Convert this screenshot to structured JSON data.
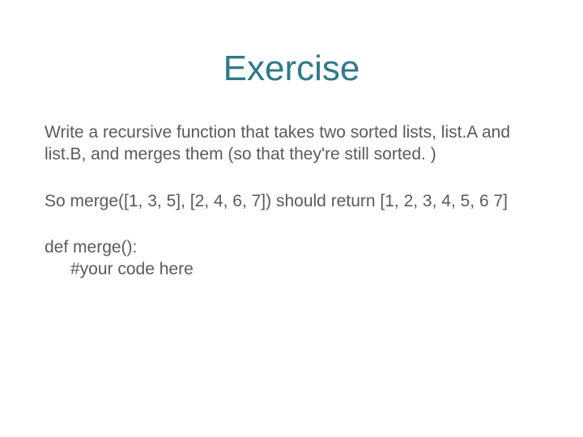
{
  "title": "Exercise",
  "p1": "Write a recursive function that takes two sorted lists, list.A and list.B, and merges them (so that they're still sorted. )",
  "p2": "So merge([1, 3, 5], [2, 4, 6, 7]) should return [1, 2, 3, 4, 5, 6 7]",
  "code_line1": "def merge():",
  "code_line2": "#your code here"
}
